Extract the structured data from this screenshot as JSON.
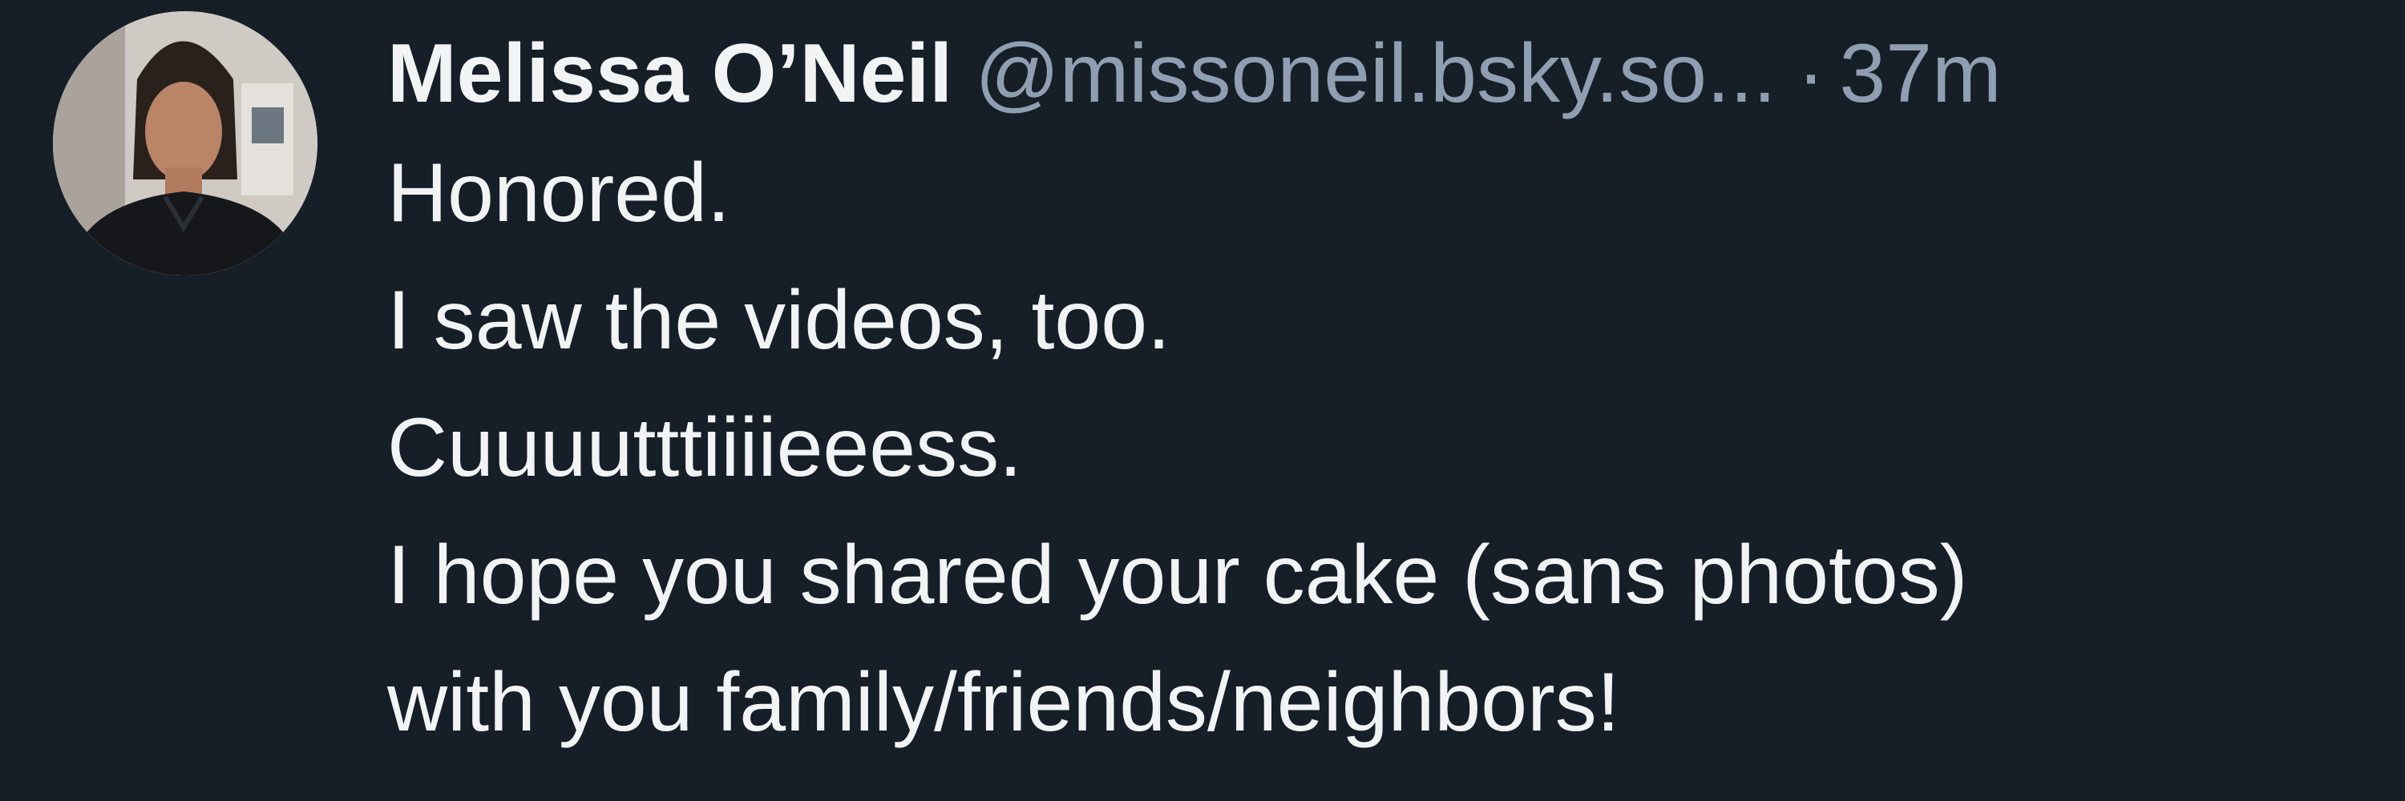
{
  "author": {
    "display_name": "Melissa O’Neil",
    "handle": "@missoneil.bsky.so...",
    "separator": "·",
    "timestamp": "37m",
    "avatar_icon": "profile-photo"
  },
  "post": {
    "lines": [
      "Honored.",
      "I saw the videos, too.",
      "Cuuuutttiiiieeess.",
      "I hope you shared your cake (sans photos)",
      "with you family/friends/neighbors!"
    ]
  },
  "colors": {
    "background": "#161e27",
    "text_primary": "#f1f3f5",
    "text_secondary": "#8f9eb0"
  }
}
